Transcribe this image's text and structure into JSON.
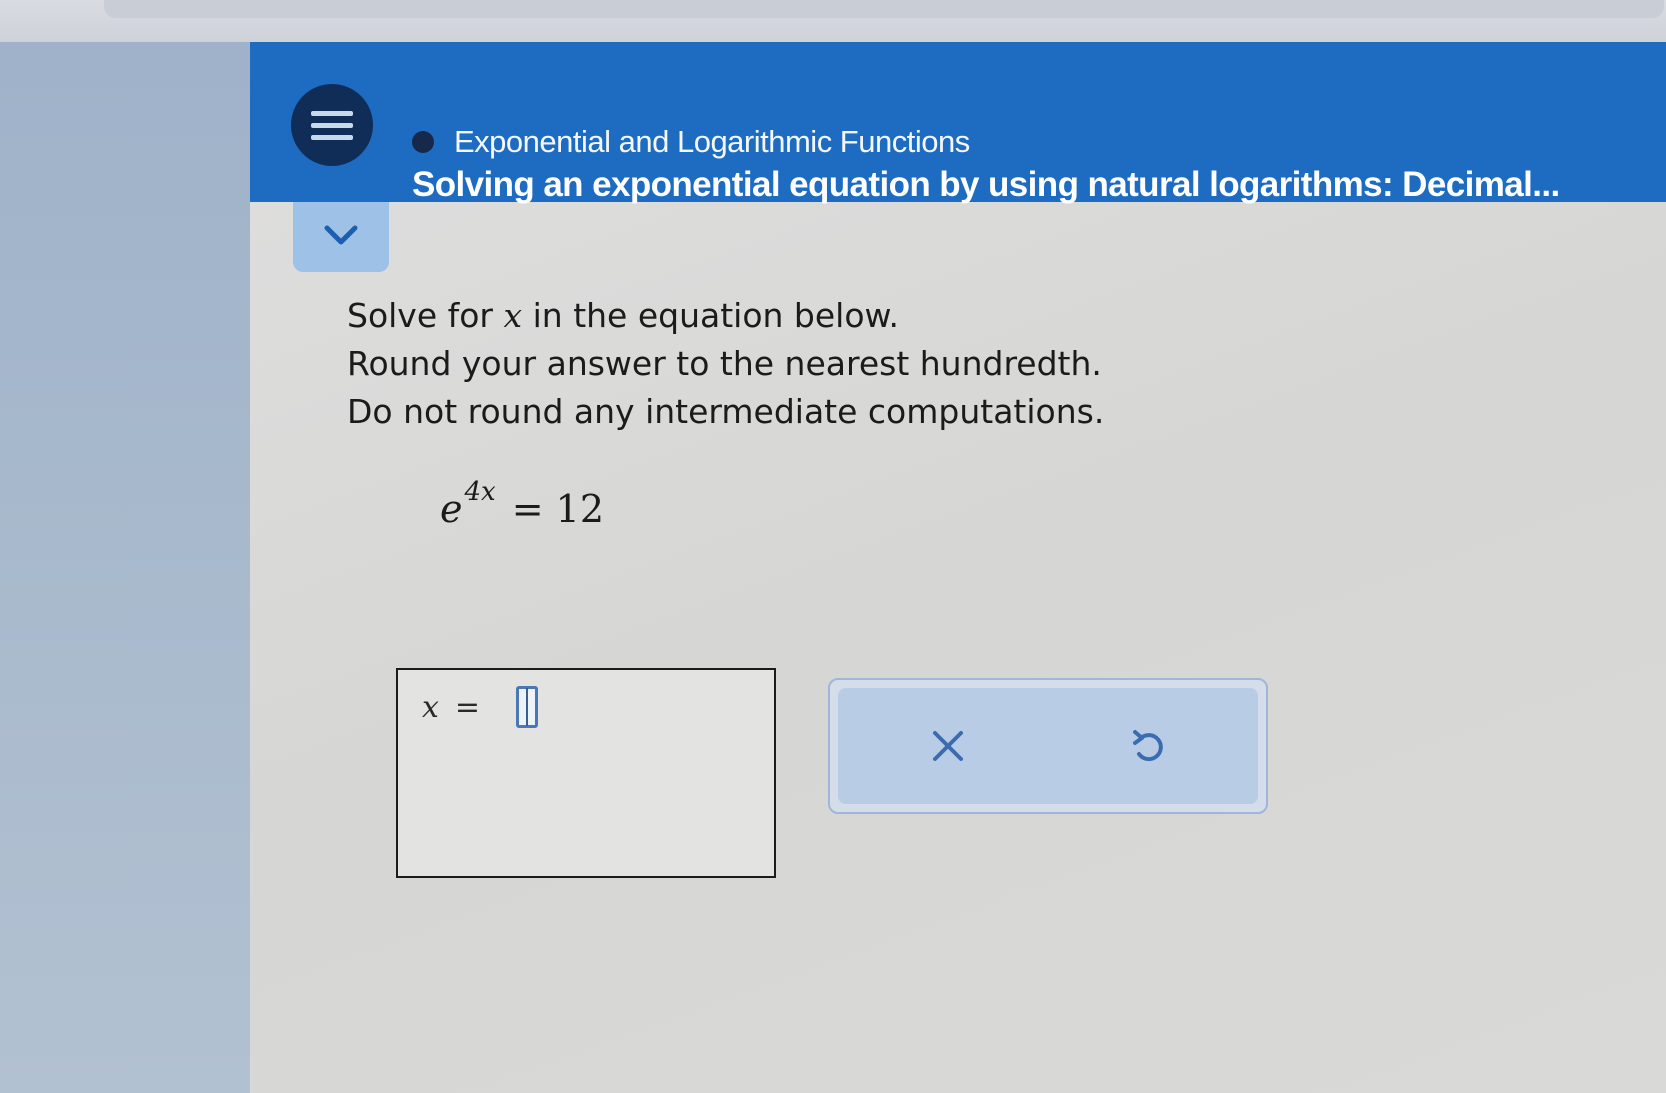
{
  "header": {
    "topic": "Exponential and Logarithmic Functions",
    "title": "Solving an exponential equation by using natural logarithms: Decimal..."
  },
  "problem": {
    "line1_prefix": "Solve for ",
    "line1_var": "x",
    "line1_suffix": " in the equation below.",
    "line2": "Round your answer to the nearest hundredth.",
    "line3": "Do not round any intermediate computations."
  },
  "equation": {
    "base": "e",
    "exponent": "4x",
    "rhs": "= 12"
  },
  "answer": {
    "variable": "x",
    "equals": "=",
    "value": ""
  },
  "icons": {
    "menu": "hamburger-icon",
    "status": "dot-icon",
    "collapse": "chevron-down-icon",
    "clear": "close-icon",
    "undo": "undo-icon"
  },
  "colors": {
    "header_blue": "#1d6cc2",
    "menu_button_navy": "#0f2d57",
    "collapse_tab": "#9ec1e8",
    "action_panel": "#b8cce6",
    "icon_blue": "#3c6cb0"
  }
}
